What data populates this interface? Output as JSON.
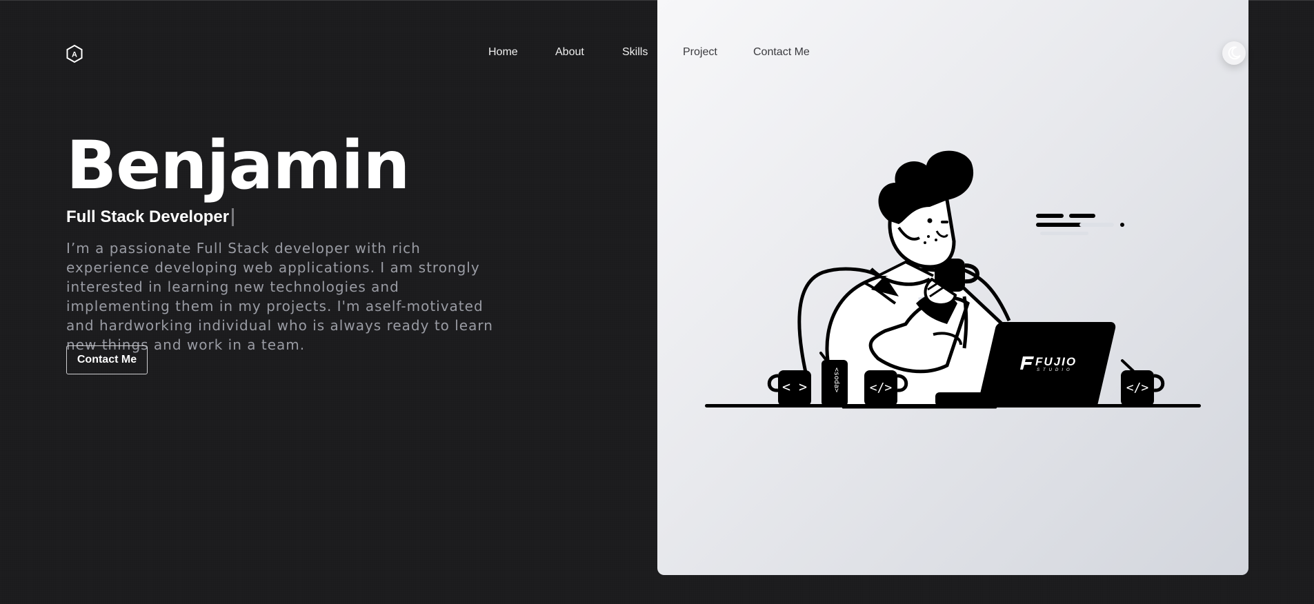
{
  "brand": {
    "logo_letter": "A"
  },
  "nav": {
    "items": [
      {
        "label": "Home"
      },
      {
        "label": "About"
      },
      {
        "label": "Skills"
      },
      {
        "label": "Project"
      },
      {
        "label": "Contact Me"
      }
    ]
  },
  "theme_toggle": {
    "icon": "moon-icon"
  },
  "hero": {
    "name": "Benjamin",
    "role": "Full Stack Developer",
    "description": "I’m a passionate Full Stack developer with rich experience developing web applications. I am strongly interested in learning new technologies and implementing them in my projects. I'm aself-motivated and hardworking individual who is always ready to learn new things and work in a team.",
    "cta_label": "Contact Me"
  },
  "illustration": {
    "laptop_brand": "FUJIO",
    "laptop_subbrand": "STUDIO",
    "mug_left": "< >",
    "mug_middle": "</>",
    "mug_right": "</>",
    "can_text": "<soda>"
  },
  "colors": {
    "background": "#1b1b1d",
    "panel": "#e8e9ed",
    "text_primary": "#ffffff",
    "text_muted": "#9a9ca4"
  }
}
